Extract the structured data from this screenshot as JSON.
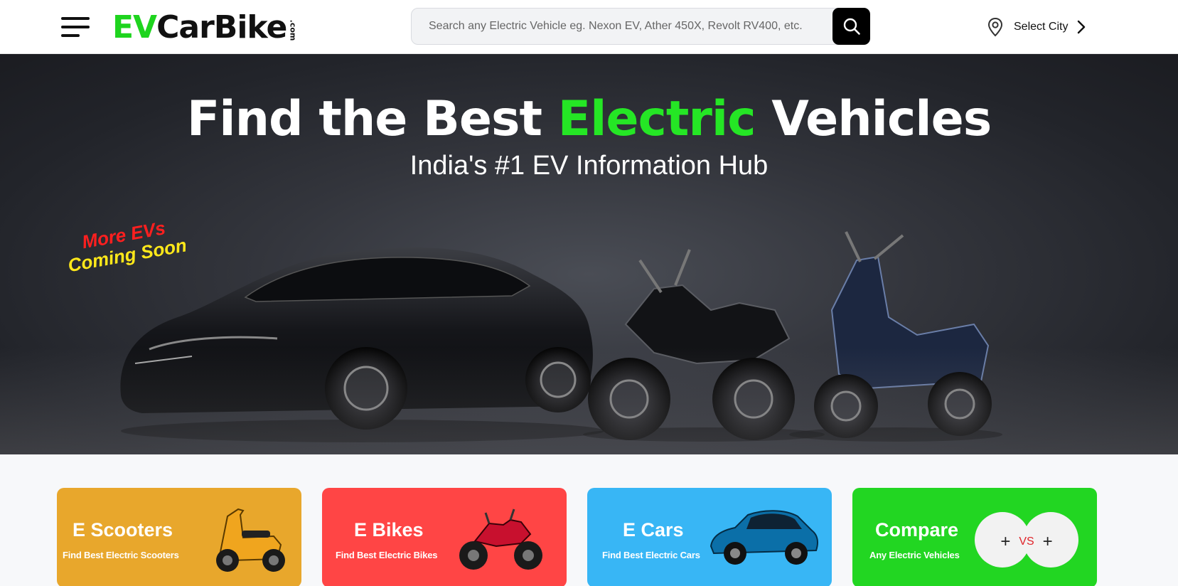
{
  "header": {
    "logo": {
      "ev": "EV",
      "carbike": "CarBike",
      "com": ".com"
    },
    "search": {
      "placeholder": "Search any Electric Vehicle eg. Nexon EV, Ather 450X, Revolt RV400, etc."
    },
    "city_label": "Select City",
    "icons": [
      "hamburger-menu-icon",
      "search-icon",
      "location-pin-icon",
      "chevron-right-icon"
    ]
  },
  "hero": {
    "title_part1": "Find the Best ",
    "title_accent": "Electric",
    "title_part2": " Vehicles",
    "subtitle": "India's #1 EV Information Hub",
    "promo_line1": "More EVs",
    "promo_line2": "Coming Soon"
  },
  "categories": [
    {
      "title": "E Scooters",
      "subtitle": "Find Best Electric Scooters",
      "color": "#e8a72c"
    },
    {
      "title": "E Bikes",
      "subtitle": "Find Best Electric Bikes",
      "color": "#ff4545"
    },
    {
      "title": "E Cars",
      "subtitle": "Find Best Electric Cars",
      "color": "#38b6f5"
    },
    {
      "title": "Compare",
      "subtitle": "Any Electric Vehicles",
      "color": "#22d622",
      "vs_label": "VS"
    }
  ],
  "colors": {
    "brand_green": "#1ed41e",
    "accent_green": "#25e625",
    "promo_red": "#ff1f1f",
    "promo_yellow": "#ffe81a"
  }
}
